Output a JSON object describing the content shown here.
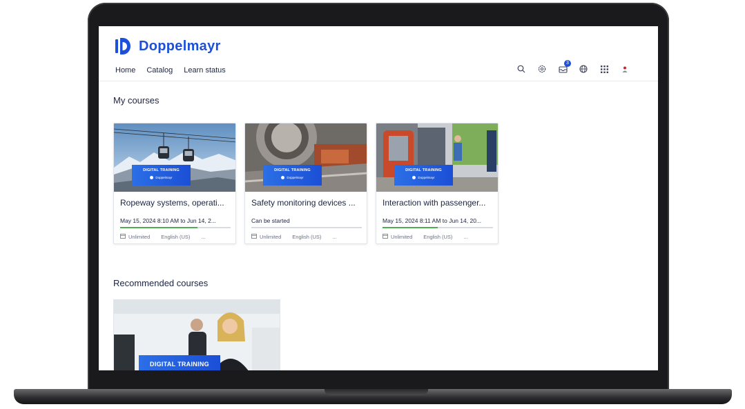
{
  "brand": {
    "name": "Doppelmayr",
    "color": "#1d4fd8"
  },
  "nav": {
    "items": [
      "Home",
      "Catalog",
      "Learn status"
    ]
  },
  "toolbar": {
    "notifications_count": "3"
  },
  "sections": {
    "my_courses": "My courses",
    "recommended": "Recommended courses"
  },
  "banner": {
    "title": "DIGITAL TRAINING",
    "sub": "Doppelmayr"
  },
  "courses": [
    {
      "title": "Ropeway systems, operati...",
      "status": "May 15, 2024 8:10 AM to Jun 14, 2...",
      "progress": 0.7,
      "duration": "Unlimited",
      "language": "English (US)",
      "more": "..."
    },
    {
      "title": "Safety monitoring devices ...",
      "status": "Can be started",
      "progress": 0.0,
      "duration": "Unlimited",
      "language": "English (US)",
      "more": "..."
    },
    {
      "title": "Interaction with passenger...",
      "status": "May 15, 2024 8:11 AM to Jun 14, 20...",
      "progress": 0.5,
      "duration": "Unlimited",
      "language": "English (US)",
      "more": "..."
    }
  ],
  "recommended": [
    {
      "banner": "DIGITAL TRAINING"
    }
  ]
}
